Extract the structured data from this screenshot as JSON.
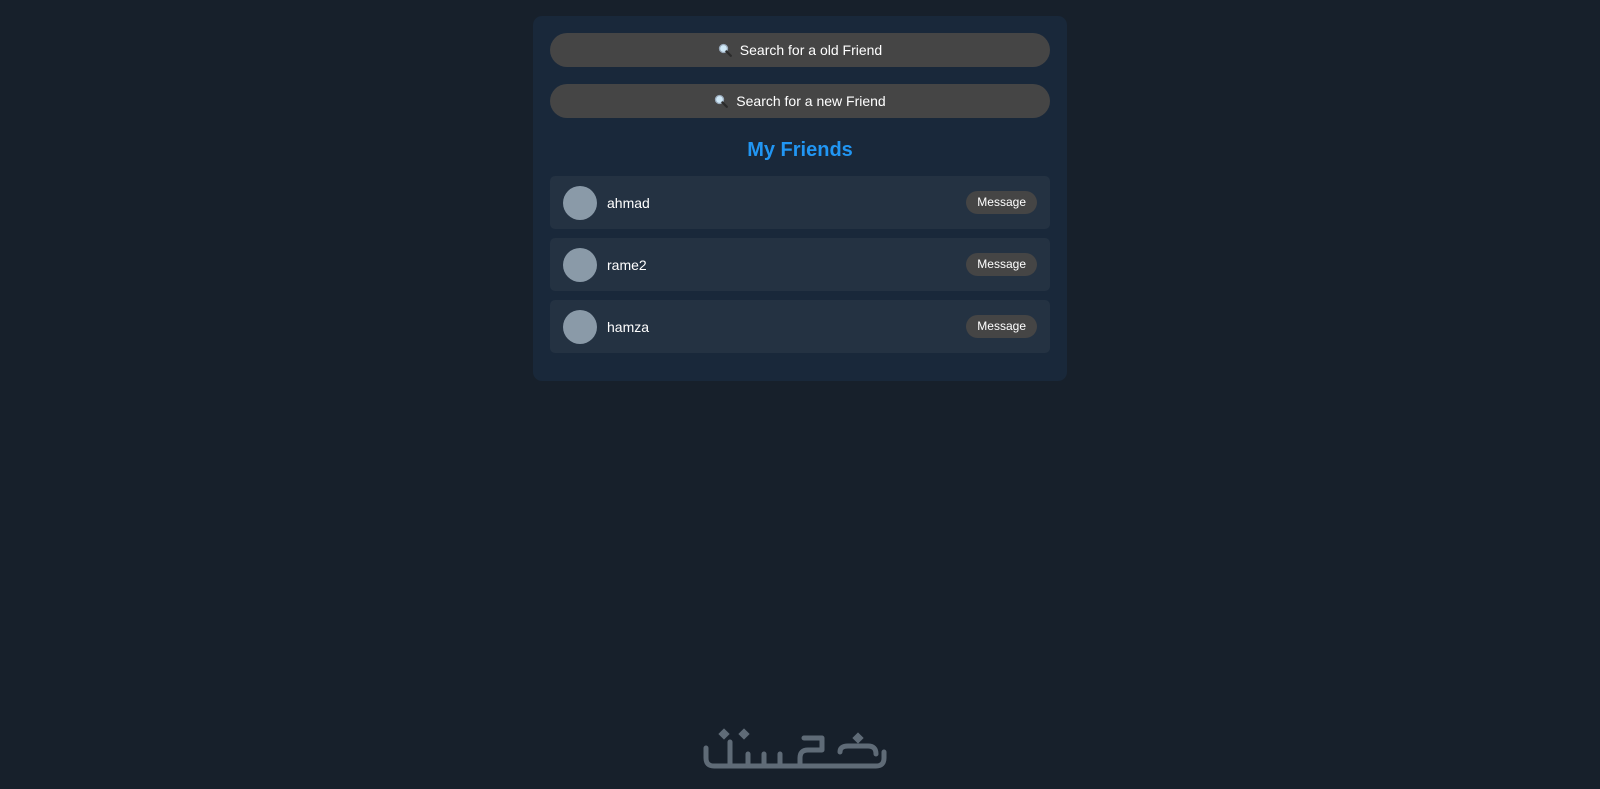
{
  "search": {
    "old_friend_label": "Search for a old Friend",
    "new_friend_label": "Search for a new Friend"
  },
  "friends": {
    "title": "My Friends",
    "items": [
      {
        "name": "ahmad",
        "action": "Message"
      },
      {
        "name": "rame2",
        "action": "Message"
      },
      {
        "name": "hamza",
        "action": "Message"
      }
    ]
  },
  "footer": {
    "logo_text": "خمسات"
  },
  "colors": {
    "background": "#17202b",
    "panel": "#19283a",
    "accent": "#2196f3",
    "button": "#454545",
    "row": "#243242",
    "avatar": "#8a9aa8"
  },
  "icons": {
    "search": "search-icon"
  }
}
